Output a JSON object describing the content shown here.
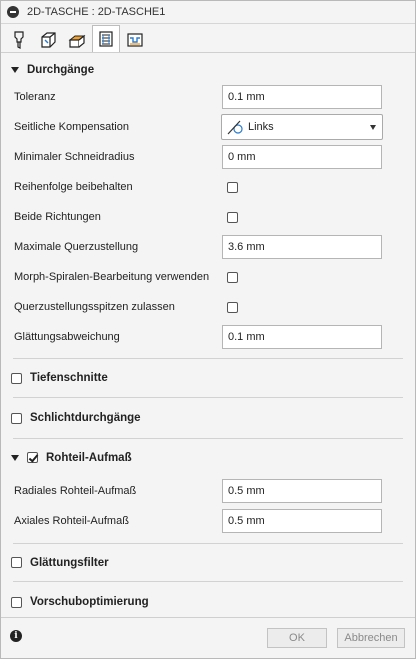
{
  "window": {
    "title": "2D-TASCHE : 2D-TASCHE1"
  },
  "tabs": [
    {
      "icon": "tool-icon",
      "active": false
    },
    {
      "icon": "geometry-icon",
      "active": false
    },
    {
      "icon": "heights-icon",
      "active": false
    },
    {
      "icon": "passes-icon",
      "active": true
    },
    {
      "icon": "linking-icon",
      "active": false
    }
  ],
  "sections": {
    "durchgaenge": {
      "title": "Durchgänge",
      "toleranz": {
        "label": "Toleranz",
        "value": "0.1 mm"
      },
      "kompensation": {
        "label": "Seitliche Kompensation",
        "value": "Links"
      },
      "min_radius": {
        "label": "Minimaler Schneidradius",
        "value": "0 mm"
      },
      "reihenfolge": {
        "label": "Reihenfolge beibehalten",
        "checked": false
      },
      "beide": {
        "label": "Beide Richtungen",
        "checked": false
      },
      "querzustellung": {
        "label": "Maximale Querzustellung",
        "value": "3.6 mm"
      },
      "morph": {
        "label": "Morph-Spiralen-Bearbeitung verwenden",
        "checked": false
      },
      "spitzen": {
        "label": "Querzustellungsspitzen zulassen",
        "checked": false
      },
      "glaettung": {
        "label": "Glättungsabweichung",
        "value": "0.1 mm"
      }
    },
    "tiefenschnitte": {
      "title": "Tiefenschnitte",
      "checked": false
    },
    "schlicht": {
      "title": "Schlichtdurchgänge",
      "checked": false
    },
    "rohteil": {
      "title": "Rohteil-Aufmaß",
      "checked": true,
      "radial": {
        "label": "Radiales Rohteil-Aufmaß",
        "value": "0.5 mm"
      },
      "axial": {
        "label": "Axiales Rohteil-Aufmaß",
        "value": "0.5 mm"
      }
    },
    "filter": {
      "title": "Glättungsfilter",
      "checked": false
    },
    "vorschub": {
      "title": "Vorschuboptimierung",
      "checked": false
    }
  },
  "footer": {
    "ok": "OK",
    "cancel": "Abbrechen"
  },
  "colors": {
    "accent": "#f0a030",
    "link_blue": "#2a7bd1"
  }
}
